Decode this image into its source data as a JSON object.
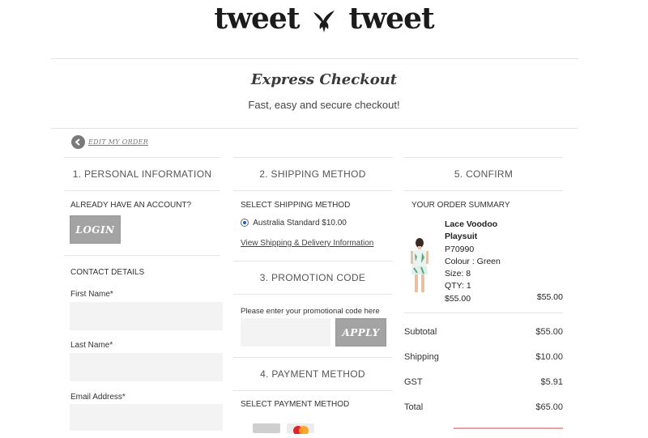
{
  "brand": {
    "left": "tweet",
    "right": "tweet"
  },
  "page": {
    "title": "Express Checkout",
    "subtitle": "Fast, easy and secure checkout!"
  },
  "nav": {
    "edit_order": "EDIT MY ORDER"
  },
  "personal": {
    "heading": "1. PERSONAL INFORMATION",
    "account_prompt": "ALREADY HAVE AN ACCOUNT?",
    "login_label": "LOGIN",
    "contact_heading": "CONTACT DETAILS",
    "first_name_label": "First Name*",
    "first_name_value": "",
    "last_name_label": "Last Name*",
    "last_name_value": "",
    "email_label": "Email Address*",
    "email_value": ""
  },
  "shipping": {
    "heading": "2. SHIPPING METHOD",
    "select_label": "SELECT SHIPPING METHOD",
    "option_label": "Australia Standard $10.00",
    "info_link": "View Shipping & Delivery Information"
  },
  "promotion": {
    "heading": "3. PROMOTION CODE",
    "prompt": "Please enter your promotional code here",
    "code_value": "",
    "apply_label": "APPLY"
  },
  "payment": {
    "heading": "4. PAYMENT METHOD",
    "select_label": "SELECT PAYMENT METHOD",
    "card_icons": [
      "generic-card-icon",
      "mastercard-icon"
    ]
  },
  "confirm": {
    "heading": "5. CONFIRM",
    "summary_label": "YOUR ORDER SUMMARY",
    "item": {
      "name_line1": "Lace Voodoo",
      "name_line2": "Playsuit",
      "sku": "P70990",
      "colour": "Colour : Green",
      "size": "Size: 8",
      "qty": "QTY: 1",
      "unit_price": "$55.00",
      "line_total": "$55.00"
    },
    "totals": [
      {
        "label": "Subtotal",
        "value": "$55.00"
      },
      {
        "label": "Shipping",
        "value": "$10.00"
      },
      {
        "label": "GST",
        "value": "$5.91"
      },
      {
        "label": "Total",
        "value": "$65.00"
      }
    ]
  },
  "colors": {
    "button_grey": "#a3a3a3",
    "field_bg": "#f4f3f3",
    "divider": "#e5e5e5",
    "radio_selected": "#1c5cc4"
  }
}
